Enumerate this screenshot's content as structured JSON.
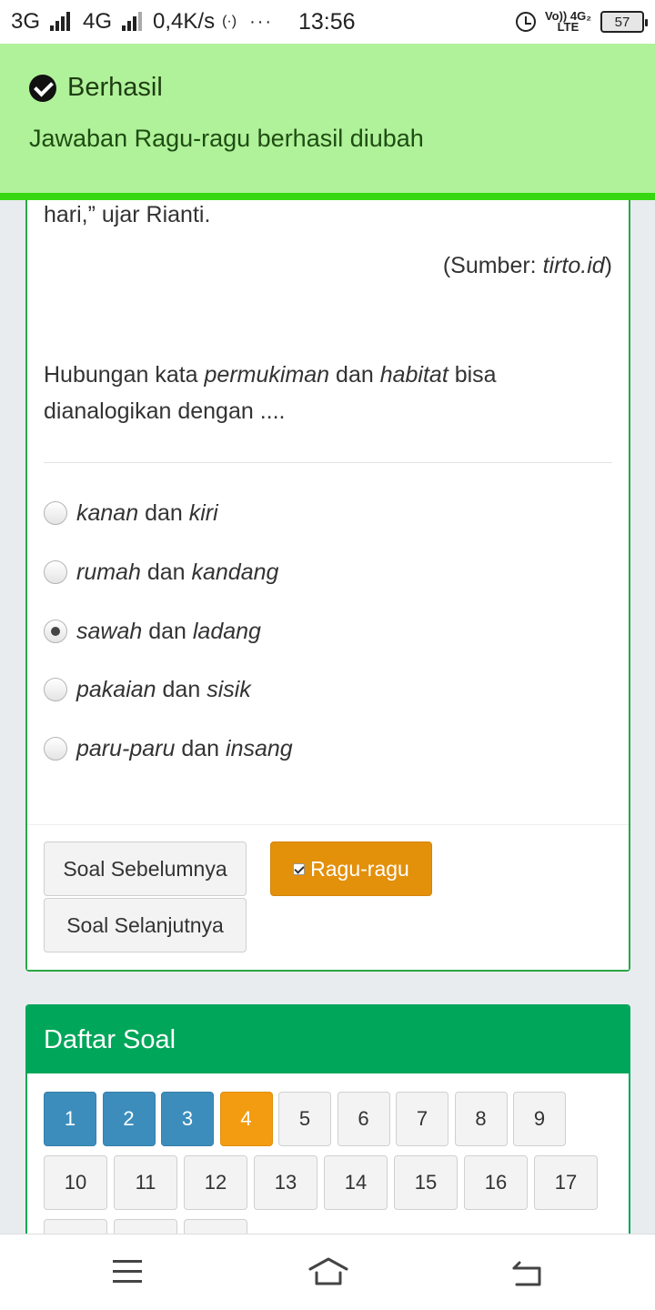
{
  "status_bar": {
    "net1": "3G",
    "net2": "4G",
    "speed": "0,4K/s",
    "more": "···",
    "time": "13:56",
    "volte_top": "Vo)) 4G₂",
    "volte_bottom": "LTE",
    "battery": "57"
  },
  "toast": {
    "title": "Berhasil",
    "message": "Jawaban Ragu-ragu berhasil diubah"
  },
  "question": {
    "passage_tail": "hari,” ujar Rianti.",
    "source_prefix": "(Sumber: ",
    "source_name": "tirto.id",
    "source_suffix": ")",
    "prompt_part1": "Hubungan kata ",
    "prompt_word1": "permukiman",
    "prompt_part2": " dan ",
    "prompt_word2": "habitat",
    "prompt_part3": " bisa",
    "prompt_line2": "dianalogikan dengan ....",
    "connector": " dan ",
    "options": [
      {
        "a": "kanan",
        "b": "kiri",
        "selected": false
      },
      {
        "a": "rumah",
        "b": "kandang",
        "selected": false
      },
      {
        "a": "sawah",
        "b": "ladang",
        "selected": true
      },
      {
        "a": "pakaian",
        "b": "sisik",
        "selected": false
      },
      {
        "a": "paru-paru",
        "b": "insang",
        "selected": false
      }
    ]
  },
  "buttons": {
    "prev": "Soal Sebelumnya",
    "doubt": "Ragu-ragu",
    "next": "Soal Selanjutnya"
  },
  "daftar": {
    "title": "Daftar Soal",
    "numbers": [
      "1",
      "2",
      "3",
      "4",
      "5",
      "6",
      "7",
      "8",
      "9",
      "10",
      "11",
      "12",
      "13",
      "14",
      "15",
      "16",
      "17"
    ],
    "answered": [
      "1",
      "2",
      "3"
    ],
    "doubtful": [
      "4"
    ]
  },
  "colors": {
    "toast_bg": "#b0f29a",
    "toast_border": "#37d812",
    "card_border": "#28a745",
    "header_green": "#00a65a",
    "answered_blue": "#3c8dbc",
    "doubt_orange": "#f39c12",
    "doubt_button": "#e3900b"
  },
  "nav": {
    "menu_icon": "menu-icon",
    "home_icon": "home-icon",
    "back_icon": "back-icon"
  }
}
